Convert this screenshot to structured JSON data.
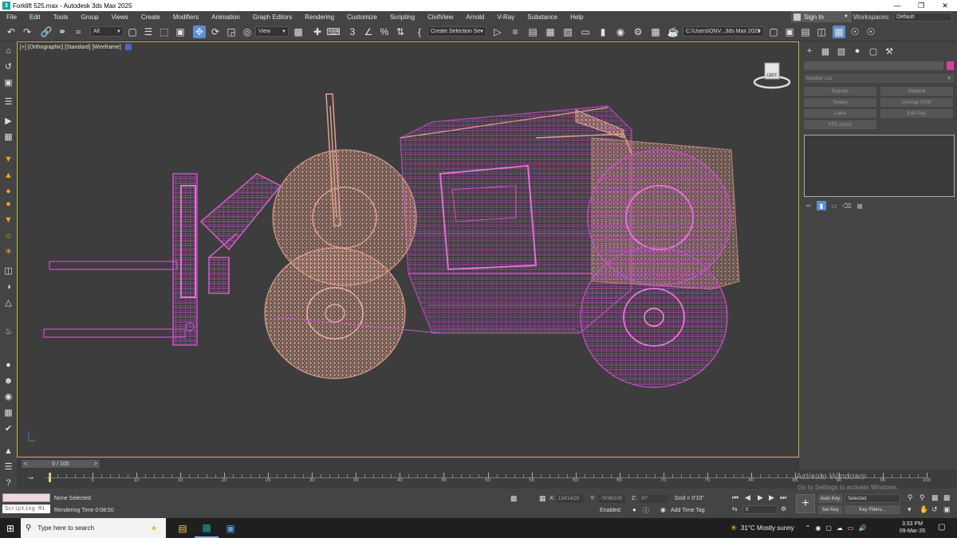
{
  "window": {
    "title": "Forklift 525.max - Autodesk 3ds Max 2025",
    "app_icon": "3ds-max-icon",
    "controls": [
      "minimize",
      "maximize",
      "close"
    ]
  },
  "menu": {
    "items": [
      "File",
      "Edit",
      "Tools",
      "Group",
      "Views",
      "Create",
      "Modifiers",
      "Animation",
      "Graph Editors",
      "Rendering",
      "Customize",
      "Scripting",
      "CivilView",
      "Arnold",
      "V-Ray",
      "Substance",
      "Help"
    ],
    "signin_label": "Sign In",
    "workspaces_label": "Workspaces:",
    "workspaces_value": "Default"
  },
  "toolbar": {
    "filter_value": "All",
    "refcoord_value": "View",
    "selection_set_value": "Create Selection Se",
    "project_path": "C:\\Users\\ONV...3ds Max 2025"
  },
  "viewport": {
    "label": "[+] [Orthographic] [Standard] [Wireframe]",
    "viewcube_face": "LEFT",
    "wire_colors": {
      "pink": "#d28caa",
      "magenta": "#c850c8"
    },
    "border_color": "#c8b23c"
  },
  "command_panel": {
    "modifier_list_label": "Modifier List",
    "object_color": "#d6409f",
    "buttons": [
      "Extrude",
      "Material",
      "Sweep",
      "Unwrap UVW",
      "Lathe",
      "Edit Poly",
      "FFD 2x2x2"
    ]
  },
  "timeline": {
    "frame_display": "0 / 100",
    "prev_arrow": "<",
    "next_arrow": ">",
    "tick_labels": [
      "0",
      "5",
      "10",
      "15",
      "20",
      "25",
      "30",
      "35",
      "40",
      "45",
      "50",
      "55",
      "60",
      "65",
      "70",
      "75",
      "80",
      "85",
      "90",
      "95",
      "100"
    ]
  },
  "status": {
    "script_label": "Scripting Mi",
    "selection_text": "None Selected",
    "render_time": "Rendering Time  0:08:50",
    "x_label": "X:",
    "x_value": "124'14/20",
    "y_label": "Y:",
    "y_value": "-76'45/100",
    "z_label": "Z:",
    "z_value": "00\"",
    "grid": "Gnd = 0'10\"",
    "enabled_label": "Enabled:",
    "add_time_tag": "Add Time Tag",
    "frame_value": "0",
    "autokey": "Auto Key",
    "setkey": "Set Key",
    "key_mode_value": "Selected",
    "key_filters": "Key Filters...",
    "activation_title": "Activate Windows",
    "activation_sub": "Go to Settings to activate Windows."
  },
  "taskbar": {
    "search_placeholder": "Type here to search",
    "weather": "31°C  Mostly sunny",
    "time": "3:33 PM",
    "date": "09-Mar-26"
  }
}
